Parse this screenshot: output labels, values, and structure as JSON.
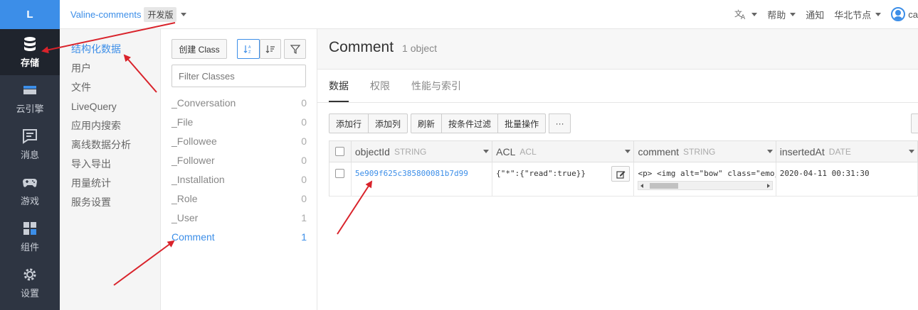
{
  "rail": {
    "logo": "L",
    "items": [
      {
        "label": "存储",
        "icon": "database-icon",
        "active": true
      },
      {
        "label": "云引擎",
        "icon": "cloud-engine-icon"
      },
      {
        "label": "消息",
        "icon": "message-icon"
      },
      {
        "label": "游戏",
        "icon": "gamepad-icon"
      },
      {
        "label": "组件",
        "icon": "component-icon"
      },
      {
        "label": "设置",
        "icon": "gear-icon"
      }
    ]
  },
  "topbar": {
    "app_name": "Valine-comments",
    "app_badge": "开发版",
    "translate_icon": "translate-icon",
    "help": "帮助",
    "notify": "通知",
    "region": "华北节点",
    "user_initial": "ca"
  },
  "subnav": {
    "items": [
      "结构化数据",
      "用户",
      "文件",
      "LiveQuery",
      "应用内搜索",
      "离线数据分析",
      "导入导出",
      "用量统计",
      "服务设置"
    ]
  },
  "classes": {
    "create_label": "创建 Class",
    "filter_placeholder": "Filter Classes",
    "list": [
      {
        "name": "_Conversation",
        "count": "0"
      },
      {
        "name": "_File",
        "count": "0"
      },
      {
        "name": "_Followee",
        "count": "0"
      },
      {
        "name": "_Follower",
        "count": "0"
      },
      {
        "name": "_Installation",
        "count": "0"
      },
      {
        "name": "_Role",
        "count": "0"
      },
      {
        "name": "_User",
        "count": "1"
      },
      {
        "name": "Comment",
        "count": "1"
      }
    ]
  },
  "main": {
    "title": "Comment",
    "count": "1 object",
    "tabs": [
      "数据",
      "权限",
      "性能与索引"
    ],
    "toolbar": {
      "add_row": "添加行",
      "add_col": "添加列",
      "refresh": "刷新",
      "filter": "按条件过滤",
      "batch": "批量操作",
      "more": "···"
    },
    "columns": [
      {
        "name": "objectId",
        "type": "STRING"
      },
      {
        "name": "ACL",
        "type": "ACL"
      },
      {
        "name": "comment",
        "type": "STRING"
      },
      {
        "name": "insertedAt",
        "type": "DATE"
      }
    ],
    "row": {
      "objectId": "5e909f625c385800081b7d99",
      "acl": "{\"*\":{\"read\":true}}",
      "comment": "<p>  <img alt=\"bow\" class=\"emoji",
      "insertedAt": "2020-04-11 00:31:30"
    }
  },
  "colors": {
    "accent": "#3c8ee8",
    "rail_bg": "#2e3542",
    "annotation": "#d9232b"
  }
}
